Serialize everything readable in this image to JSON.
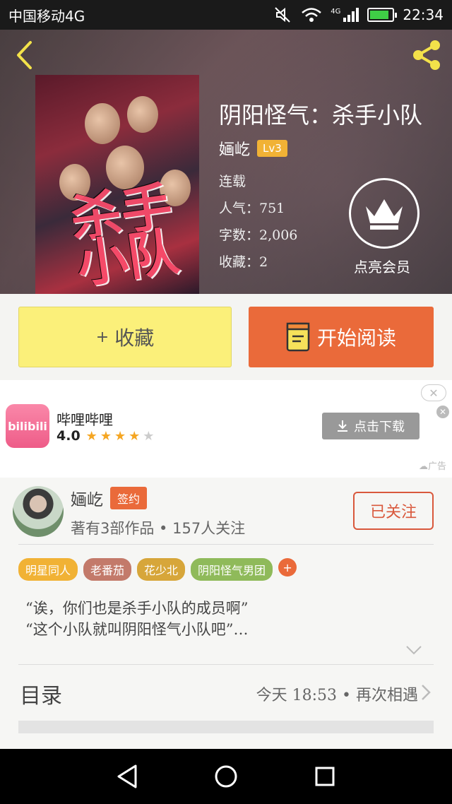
{
  "status_bar": {
    "carrier": "中国移动4G",
    "network": "4G",
    "time": "22:34"
  },
  "header": {
    "back_icon": "chevron-left-icon",
    "share_icon": "share-icon"
  },
  "book": {
    "title": "阴阳怪气：杀手小队",
    "author": "婳屹",
    "level": "Lv3",
    "status": "连载",
    "popularity": "人气：751",
    "word_count": "字数：2,006",
    "favorites": "收藏：2",
    "cover_text": "杀手小队"
  },
  "vip": {
    "label": "点亮会员",
    "icon": "crown-icon"
  },
  "actions": {
    "collect_plus": "+",
    "collect_label": "收藏",
    "read_label": "开始阅读",
    "read_icon": "book-icon"
  },
  "ad": {
    "app_name": "哔哩哔哩",
    "icon_text": "bilibili",
    "rating": "4.0",
    "stars_filled": 4,
    "stars_total": 5,
    "download_label": "点击下载",
    "ad_label": "广告"
  },
  "author_card": {
    "name": "婳屹",
    "signed_badge": "签约",
    "stats": "著有3部作品 • 157人关注",
    "follow_label": "已关注"
  },
  "tags": [
    {
      "label": "明星同人",
      "color": "#f1b235"
    },
    {
      "label": "老番茄",
      "color": "#c37a6a"
    },
    {
      "label": "花少北",
      "color": "#d7a63a"
    },
    {
      "label": "阴阳怪气男团",
      "color": "#8fba5a"
    }
  ],
  "tag_add": "+",
  "description": {
    "line1": "“诶，你们也是杀手小队的成员啊”",
    "line2": "“这个小队就叫阴阳怪气小队吧”…"
  },
  "toc": {
    "label": "目录",
    "latest": "今天 18:53 • 再次相遇"
  },
  "colors": {
    "accent": "#ea6a3a",
    "collect_bg": "#fbf07a",
    "level_badge": "#f1b235"
  }
}
